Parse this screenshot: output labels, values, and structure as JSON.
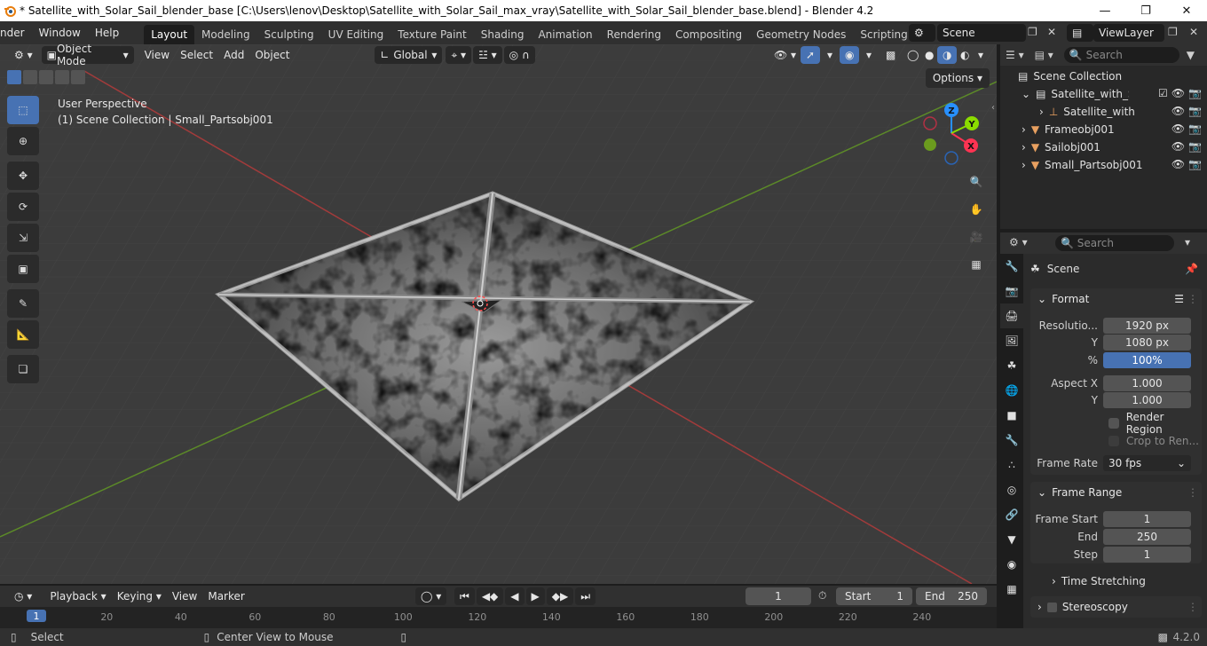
{
  "window": {
    "title": "* Satellite_with_Solar_Sail_blender_base [C:\\Users\\lenov\\Desktop\\Satellite_with_Solar_Sail_max_vray\\Satellite_with_Solar_Sail_blender_base.blend] - Blender 4.2"
  },
  "menu": {
    "render": "nder",
    "window": "Window",
    "help": "Help"
  },
  "workspaces": [
    {
      "label": "Layout",
      "active": true
    },
    {
      "label": "Modeling"
    },
    {
      "label": "Sculpting"
    },
    {
      "label": "UV Editing"
    },
    {
      "label": "Texture Paint"
    },
    {
      "label": "Shading"
    },
    {
      "label": "Animation"
    },
    {
      "label": "Rendering"
    },
    {
      "label": "Compositing"
    },
    {
      "label": "Geometry Nodes"
    },
    {
      "label": "Scripting"
    }
  ],
  "scene_selector": {
    "value": "Scene"
  },
  "view_layer": {
    "value": "ViewLayer"
  },
  "viewport": {
    "mode": "Object Mode",
    "menus": [
      "View",
      "Select",
      "Add",
      "Object"
    ],
    "transform_orientation": "Global",
    "perspective_label": "User Perspective",
    "collection_label": "(1) Scene Collection | Small_Partsobj001",
    "options_label": "Options",
    "gizmo": {
      "x": "X",
      "y": "Y",
      "z": "Z"
    }
  },
  "outliner": {
    "search_placeholder": "Search",
    "rows": [
      {
        "label": "Scene Collection"
      },
      {
        "label": "Satellite_with_Solar"
      },
      {
        "label": "Satellite_with_S"
      },
      {
        "label": "Frameobj001"
      },
      {
        "label": "Sailobj001"
      },
      {
        "label": "Small_Partsobj001"
      }
    ]
  },
  "properties": {
    "search_placeholder": "Search",
    "context": "Scene",
    "format": {
      "title": "Format",
      "resolution_x_label": "Resolutio...",
      "resolution_x": "1920 px",
      "resolution_y_label": "Y",
      "resolution_y": "1080 px",
      "percent_label": "%",
      "percent": "100%",
      "aspect_x_label": "Aspect X",
      "aspect_x": "1.000",
      "aspect_y_label": "Y",
      "aspect_y": "1.000",
      "render_region": "Render Region",
      "crop": "Crop to Ren...",
      "frame_rate_label": "Frame Rate",
      "frame_rate": "30 fps"
    },
    "frame_range": {
      "title": "Frame Range",
      "start_label": "Frame Start",
      "start": "1",
      "end_label": "End",
      "end": "250",
      "step_label": "Step",
      "step": "1"
    },
    "time_stretching": "Time Stretching",
    "stereoscopy": "Stereoscopy"
  },
  "timeline": {
    "menus": [
      "Playback",
      "Keying",
      "View",
      "Marker"
    ],
    "current_frame": "1",
    "start_label": "Start",
    "start": "1",
    "end_label": "End",
    "end": "250",
    "ticks": [
      "1",
      "20",
      "40",
      "60",
      "80",
      "100",
      "120",
      "140",
      "160",
      "180",
      "200",
      "220",
      "240"
    ]
  },
  "statusbar": {
    "select": "Select",
    "center_view": "Center View to Mouse",
    "version": "4.2.0"
  },
  "colors": {
    "accent": "#4772b3",
    "x_axis": "#ff3352",
    "y_axis": "#8bdc00",
    "z_axis": "#2890ff"
  }
}
